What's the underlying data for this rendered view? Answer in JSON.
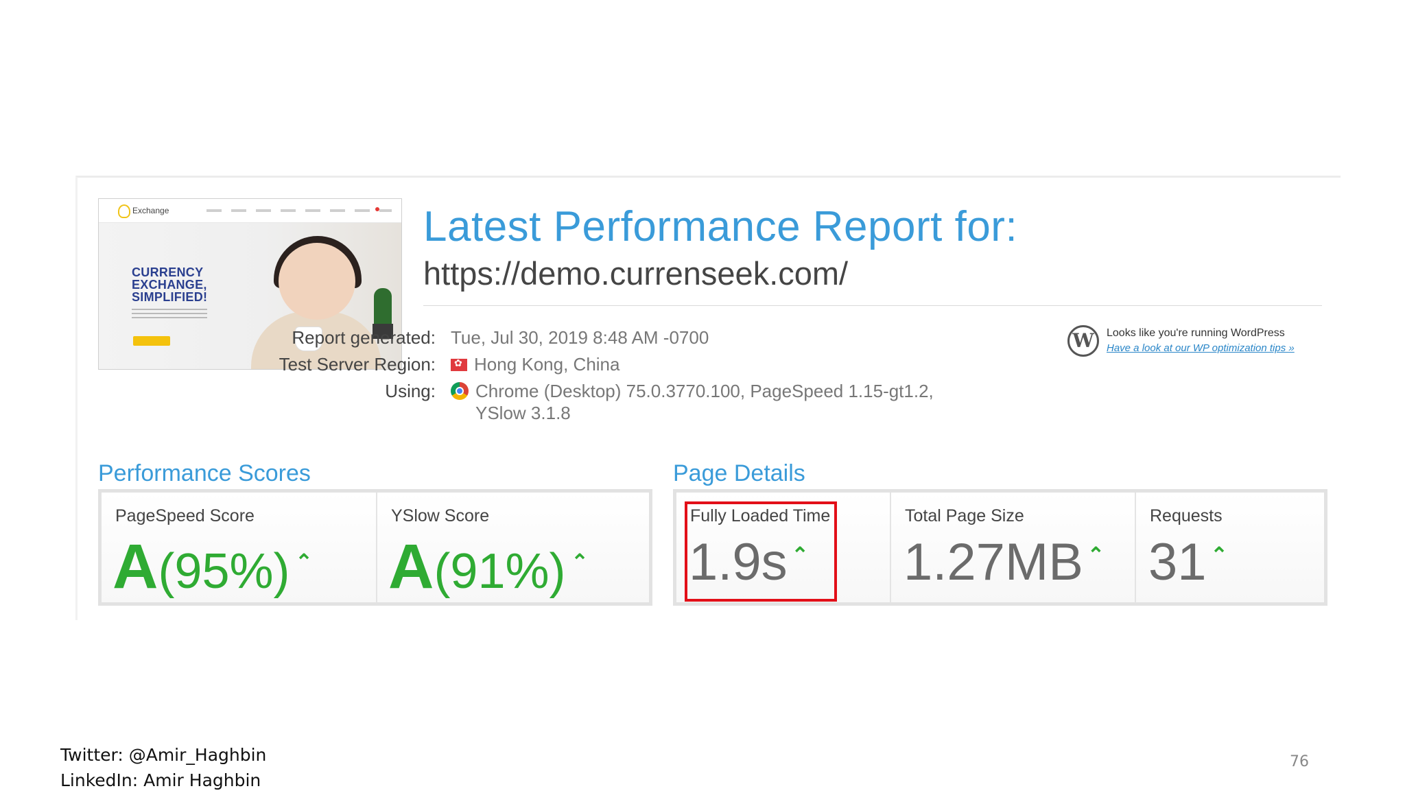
{
  "report": {
    "title": "Latest Performance Report for:",
    "url": "https://demo.currenseek.com/",
    "thumbnail": {
      "brand": "Exchange",
      "headline_lines": [
        "CURRENCY",
        "EXCHANGE,",
        "SIMPLIFIED!"
      ]
    },
    "meta": [
      {
        "label": "Report generated:",
        "value": "Tue, Jul 30, 2019 8:48 AM -0700"
      },
      {
        "label": "Test Server Region:",
        "value": "Hong Kong, China"
      },
      {
        "label": "Using:",
        "value_line1": "Chrome (Desktop) 75.0.3770.100, PageSpeed 1.15-gt1.2,",
        "value_line2": "YSlow 3.1.8"
      }
    ],
    "wordpress": {
      "icon_letter": "W",
      "text": "Looks like you're running WordPress",
      "link": "Have a look at our WP optimization tips »"
    }
  },
  "performance_scores": {
    "title": "Performance Scores",
    "items": [
      {
        "label": "PageSpeed Score",
        "grade": "A",
        "percent": "(95%)",
        "caret": "⌃"
      },
      {
        "label": "YSlow Score",
        "grade": "A",
        "percent": "(91%)",
        "caret": "⌃"
      }
    ]
  },
  "page_details": {
    "title": "Page Details",
    "items": [
      {
        "label": "Fully Loaded Time",
        "value": "1.9s",
        "caret": "⌃"
      },
      {
        "label": "Total Page Size",
        "value": "1.27MB",
        "caret": "⌃"
      },
      {
        "label": "Requests",
        "value": "31",
        "caret": "⌃"
      }
    ]
  },
  "colors": {
    "accent_blue": "#3a9bd9",
    "grade_green": "#2fab33",
    "highlight_red": "#e20f18"
  },
  "footer": {
    "twitter": "Twitter: @Amir_Haghbin",
    "linkedin": "LinkedIn: Amir Haghbin",
    "page_number": "76"
  }
}
